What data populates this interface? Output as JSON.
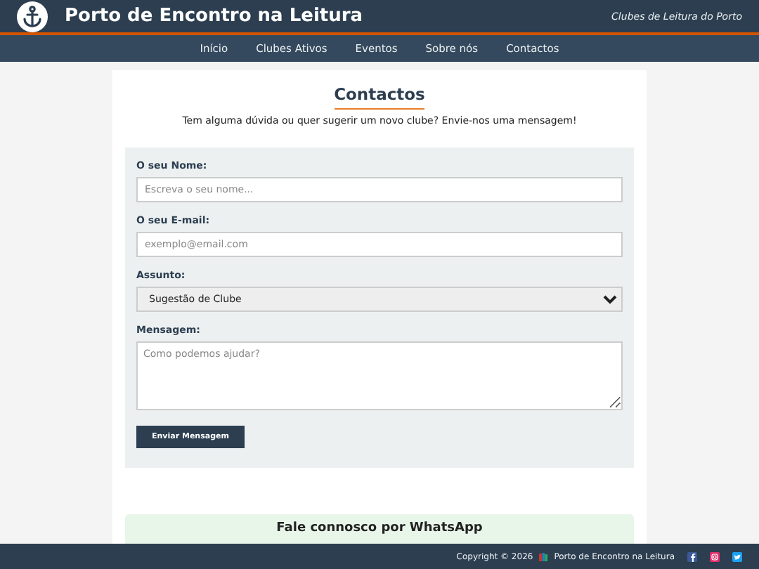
{
  "header": {
    "title": "Porto de Encontro na Leitura",
    "tagline": "Clubes de Leitura do Porto"
  },
  "nav": [
    {
      "label": "Início",
      "selected": false
    },
    {
      "label": "Clubes Ativos",
      "selected": false
    },
    {
      "label": "Eventos",
      "selected": false
    },
    {
      "label": "Sobre nós",
      "selected": false
    },
    {
      "label": "Contactos",
      "selected": false
    }
  ],
  "page": {
    "title": "Contactos",
    "intro": "Tem alguma dúvida ou quer sugerir um novo clube? Envie-nos uma mensagem!"
  },
  "form": {
    "fields": [
      {
        "kind": "text",
        "label": "O seu Nome:",
        "placeholder": "Escreva o seu nome..."
      },
      {
        "kind": "text",
        "label": "O seu E-mail:",
        "placeholder": "exemplo@email.com"
      },
      {
        "kind": "select",
        "label": "Assunto:",
        "value": "Sugestão de Clube"
      },
      {
        "kind": "textarea",
        "label": "Mensagem:",
        "placeholder": "Como podemos ajudar?"
      }
    ],
    "submit": "Enviar Mensagem"
  },
  "whatsapp": {
    "title": "Fale connosco por WhatsApp"
  },
  "footer": {
    "copyright": "Copyright © 2026",
    "site": "Porto de Encontro na Leitura",
    "social": [
      {
        "kind": "facebook",
        "color": "#3b5998"
      },
      {
        "kind": "instagram",
        "color": "#e1306c"
      },
      {
        "kind": "twitter",
        "color": "#1da1f2"
      }
    ]
  }
}
